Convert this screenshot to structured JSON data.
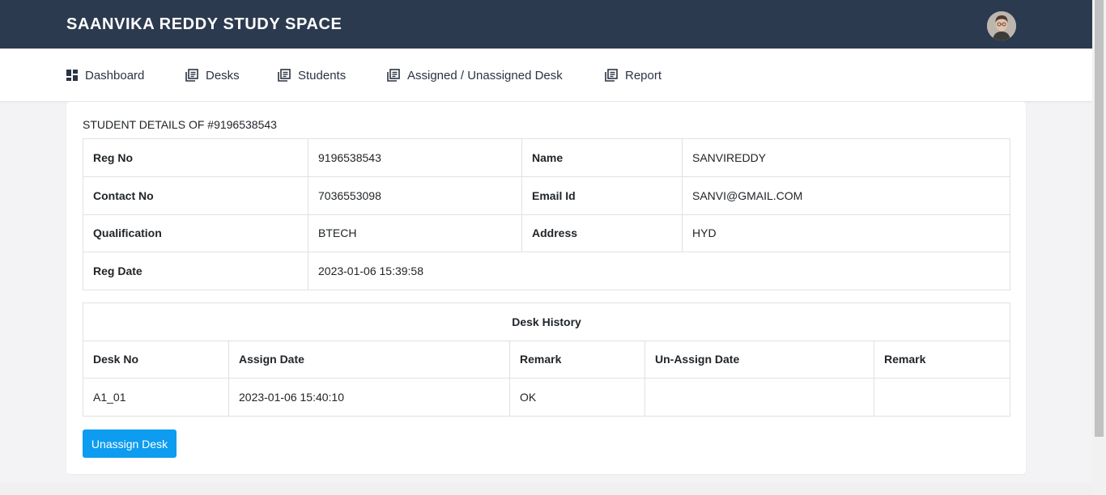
{
  "header": {
    "brand": "SAANVIKA REDDY STUDY SPACE",
    "avatar_icon": "user-avatar"
  },
  "nav": {
    "items": [
      {
        "label": "Dashboard",
        "icon": "dashboard-icon"
      },
      {
        "label": "Desks",
        "icon": "list-icon"
      },
      {
        "label": "Students",
        "icon": "list-icon"
      },
      {
        "label": "Assigned / Unassigned Desk",
        "icon": "list-icon"
      },
      {
        "label": "Report",
        "icon": "list-icon"
      }
    ]
  },
  "student": {
    "title": "STUDENT DETAILS OF #9196538543",
    "reg_no_label": "Reg No",
    "reg_no": "9196538543",
    "name_label": "Name",
    "name": "SANVIREDDY",
    "contact_label": "Contact No",
    "contact": "7036553098",
    "email_label": "Email Id",
    "email": "SANVI@GMAIL.COM",
    "qualification_label": "Qualification",
    "qualification": "BTECH",
    "address_label": "Address",
    "address": "HYD",
    "reg_date_label": "Reg Date",
    "reg_date": "2023-01-06 15:39:58"
  },
  "history": {
    "caption": "Desk History",
    "columns": [
      "Desk No",
      "Assign Date",
      "Remark",
      "Un-Assign Date",
      "Remark"
    ],
    "rows": [
      [
        "A1_01",
        "2023-01-06 15:40:10",
        "OK",
        "",
        ""
      ]
    ]
  },
  "actions": {
    "unassign_label": "Unassign Desk"
  },
  "colors": {
    "topbar": "#2c3a4f",
    "button": "#0d9cf0"
  }
}
